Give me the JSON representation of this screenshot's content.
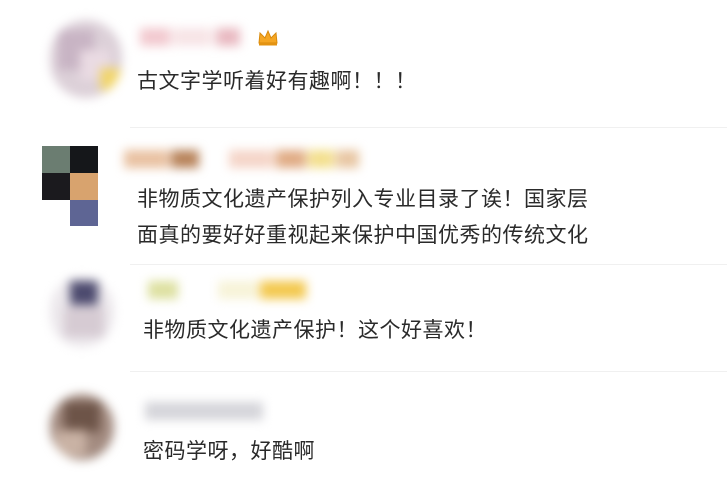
{
  "comments": [
    {
      "author_blurred": true,
      "has_vip_badge": true,
      "text_lines": [
        "古文字学听着好有趣啊！！！"
      ]
    },
    {
      "author_blurred": true,
      "has_vip_badge": false,
      "text_lines": [
        "非物质文化遗产保护列入专业目录了诶！国家层",
        "面真的要好好重视起来保护中国优秀的传统文化"
      ]
    },
    {
      "author_blurred": true,
      "has_vip_badge": false,
      "text_lines": [
        "非物质文化遗产保护！这个好喜欢！"
      ]
    },
    {
      "author_blurred": true,
      "has_vip_badge": false,
      "text_lines": [
        "密码学呀，好酷啊"
      ]
    }
  ],
  "colors": {
    "text": "#2a2a2a",
    "vip_badge": "#f5a623"
  },
  "icons": {
    "vip_badge": "crown-icon"
  }
}
